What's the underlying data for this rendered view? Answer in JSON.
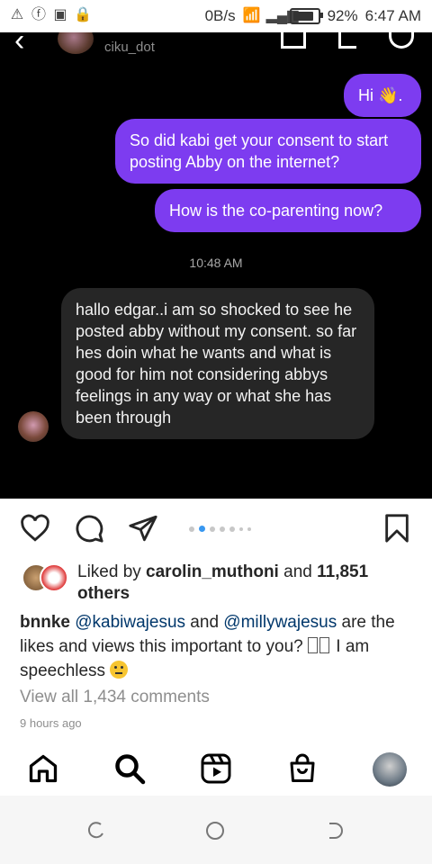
{
  "status_bar": {
    "network_speed": "0B/s",
    "battery_percent": "92%",
    "time": "6:47 AM",
    "notification_icons": [
      "alert-icon",
      "facebook-icon",
      "image-icon",
      "lock-icon"
    ]
  },
  "dm": {
    "username": "ciku_dot",
    "messages_sent": [
      "Hi 👋.",
      "So did kabi get your consent to start posting Abby on the internet?",
      "How is the co-parenting now?"
    ],
    "timestamp": "10:48 AM",
    "message_received": "hallo edgar..i am so shocked to see he posted abby without my consent. so far hes doin what he wants and what is good for him not considering abbys feelings in any way or what she has been through"
  },
  "post": {
    "liked_by_prefix": "Liked by ",
    "liked_by_user": "carolin_muthoni",
    "liked_and": " and ",
    "likes_count": "11,851",
    "likes_suffix": "others",
    "caption_user": "bnnke",
    "mention_1": "@kabiwajesus",
    "caption_and": " and ",
    "mention_2": "@millywajesus",
    "caption_text": " are the likes and views this important to you? ",
    "caption_end": " I am speechless ",
    "view_comments": "View all 1,434 comments",
    "time_ago": "9 hours ago",
    "carousel_dots": 7,
    "carousel_active_index": 1
  },
  "colors": {
    "sent_bubble": "#7d3cf0",
    "received_bubble": "#262626",
    "mention": "#00376b",
    "carousel_active": "#3897f0"
  }
}
